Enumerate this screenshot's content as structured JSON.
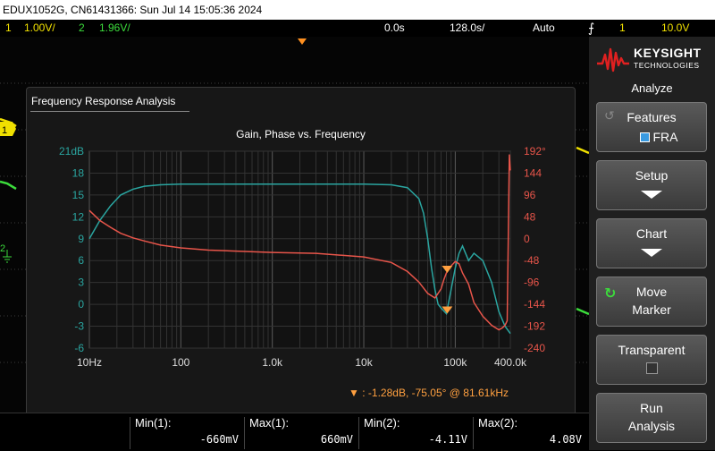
{
  "titlebar": {
    "text": "EDUX1052G, CN61431366: Sun Jul 14 15:05:36 2024"
  },
  "status": {
    "ch1_num": "1",
    "ch1_scale": "1.00V/",
    "ch2_num": "2",
    "ch2_scale": "1.96V/",
    "time_delay": "0.0s",
    "time_scale": "128.0s/",
    "trigger_mode": "Auto",
    "trigger_channel": "1",
    "trigger_level": "10.0V"
  },
  "softpanel": {
    "brand": "KEYSIGHT",
    "brand_sub": "TECHNOLOGIES",
    "menu_title": "Analyze",
    "keys": [
      {
        "l1": "Features",
        "l2": "FRA"
      },
      {
        "l1": "Setup"
      },
      {
        "l1": "Chart"
      },
      {
        "l1": "Move",
        "l2": "Marker"
      },
      {
        "l1": "Transparent"
      },
      {
        "l1": "Run",
        "l2": "Analysis"
      }
    ]
  },
  "fra": {
    "window_title": "Frequency Response Analysis",
    "chart_title": "Gain, Phase vs. Frequency",
    "marker_readout": "-1.28dB, -75.05° @ 81.61kHz",
    "marker_prefix": ":"
  },
  "measurements": [
    {
      "label": "Min(1):",
      "value": "-660mV"
    },
    {
      "label": "Max(1):",
      "value": "660mV"
    },
    {
      "label": "Min(2):",
      "value": "-4.11V"
    },
    {
      "label": "Max(2):",
      "value": "4.08V"
    }
  ],
  "chart_data": {
    "type": "line",
    "title": "Gain, Phase vs. Frequency",
    "x_scale": "log",
    "x_ticks": [
      "10Hz",
      "100",
      "1.0k",
      "10k",
      "100k",
      "400.0k"
    ],
    "gain_ticks": [
      "21dB",
      "18",
      "15",
      "12",
      "9",
      "6",
      "3",
      "0",
      "-3",
      "-6"
    ],
    "phase_ticks": [
      "192°",
      "144",
      "96",
      "48",
      "0",
      "-48",
      "-96",
      "-144",
      "-192",
      "-240"
    ],
    "gain_range": [
      -6,
      21
    ],
    "phase_range": [
      -240,
      192
    ],
    "colors": {
      "gain": "#2aa5a0",
      "phase": "#e8554a",
      "marker": "#ffa040"
    },
    "series": [
      {
        "axis": "gain",
        "x": [
          10,
          13,
          17,
          22,
          30,
          40,
          60,
          100,
          200,
          500,
          1000,
          3000,
          10000,
          20000,
          30000,
          40000,
          45000,
          50000,
          55000,
          60000,
          65000,
          70000,
          80000,
          90000,
          100000,
          110000,
          120000,
          140000,
          160000,
          200000,
          250000,
          300000,
          350000,
          400000
        ],
        "y": [
          9,
          11.5,
          13.5,
          15,
          15.8,
          16.2,
          16.4,
          16.5,
          16.5,
          16.5,
          16.5,
          16.5,
          16.5,
          16.4,
          16,
          14.5,
          12.5,
          9,
          5,
          2,
          0,
          -0.5,
          -1.28,
          2,
          5,
          7,
          8,
          6,
          7,
          6,
          3,
          -1,
          -3,
          -4
        ]
      },
      {
        "axis": "phase",
        "x": [
          10,
          13,
          17,
          22,
          30,
          40,
          60,
          100,
          200,
          500,
          1000,
          3000,
          10000,
          20000,
          30000,
          40000,
          50000,
          60000,
          70000,
          75000,
          80000,
          90000,
          100000,
          110000,
          120000,
          140000,
          160000,
          200000,
          250000,
          300000,
          330000,
          350000,
          370000,
          380000,
          390000,
          400000
        ],
        "y": [
          62,
          40,
          25,
          12,
          2,
          -5,
          -14,
          -20,
          -25,
          -28,
          -30,
          -32,
          -40,
          -52,
          -72,
          -95,
          -120,
          -130,
          -110,
          -90,
          -75,
          -60,
          -50,
          -55,
          -75,
          -100,
          -140,
          -170,
          -190,
          -200,
          -195,
          -190,
          -180,
          0,
          185,
          150
        ]
      }
    ],
    "marker_gain": {
      "x": 81610,
      "y": -1.28
    },
    "marker_phase": {
      "x": 81610,
      "y": -75.05
    }
  }
}
